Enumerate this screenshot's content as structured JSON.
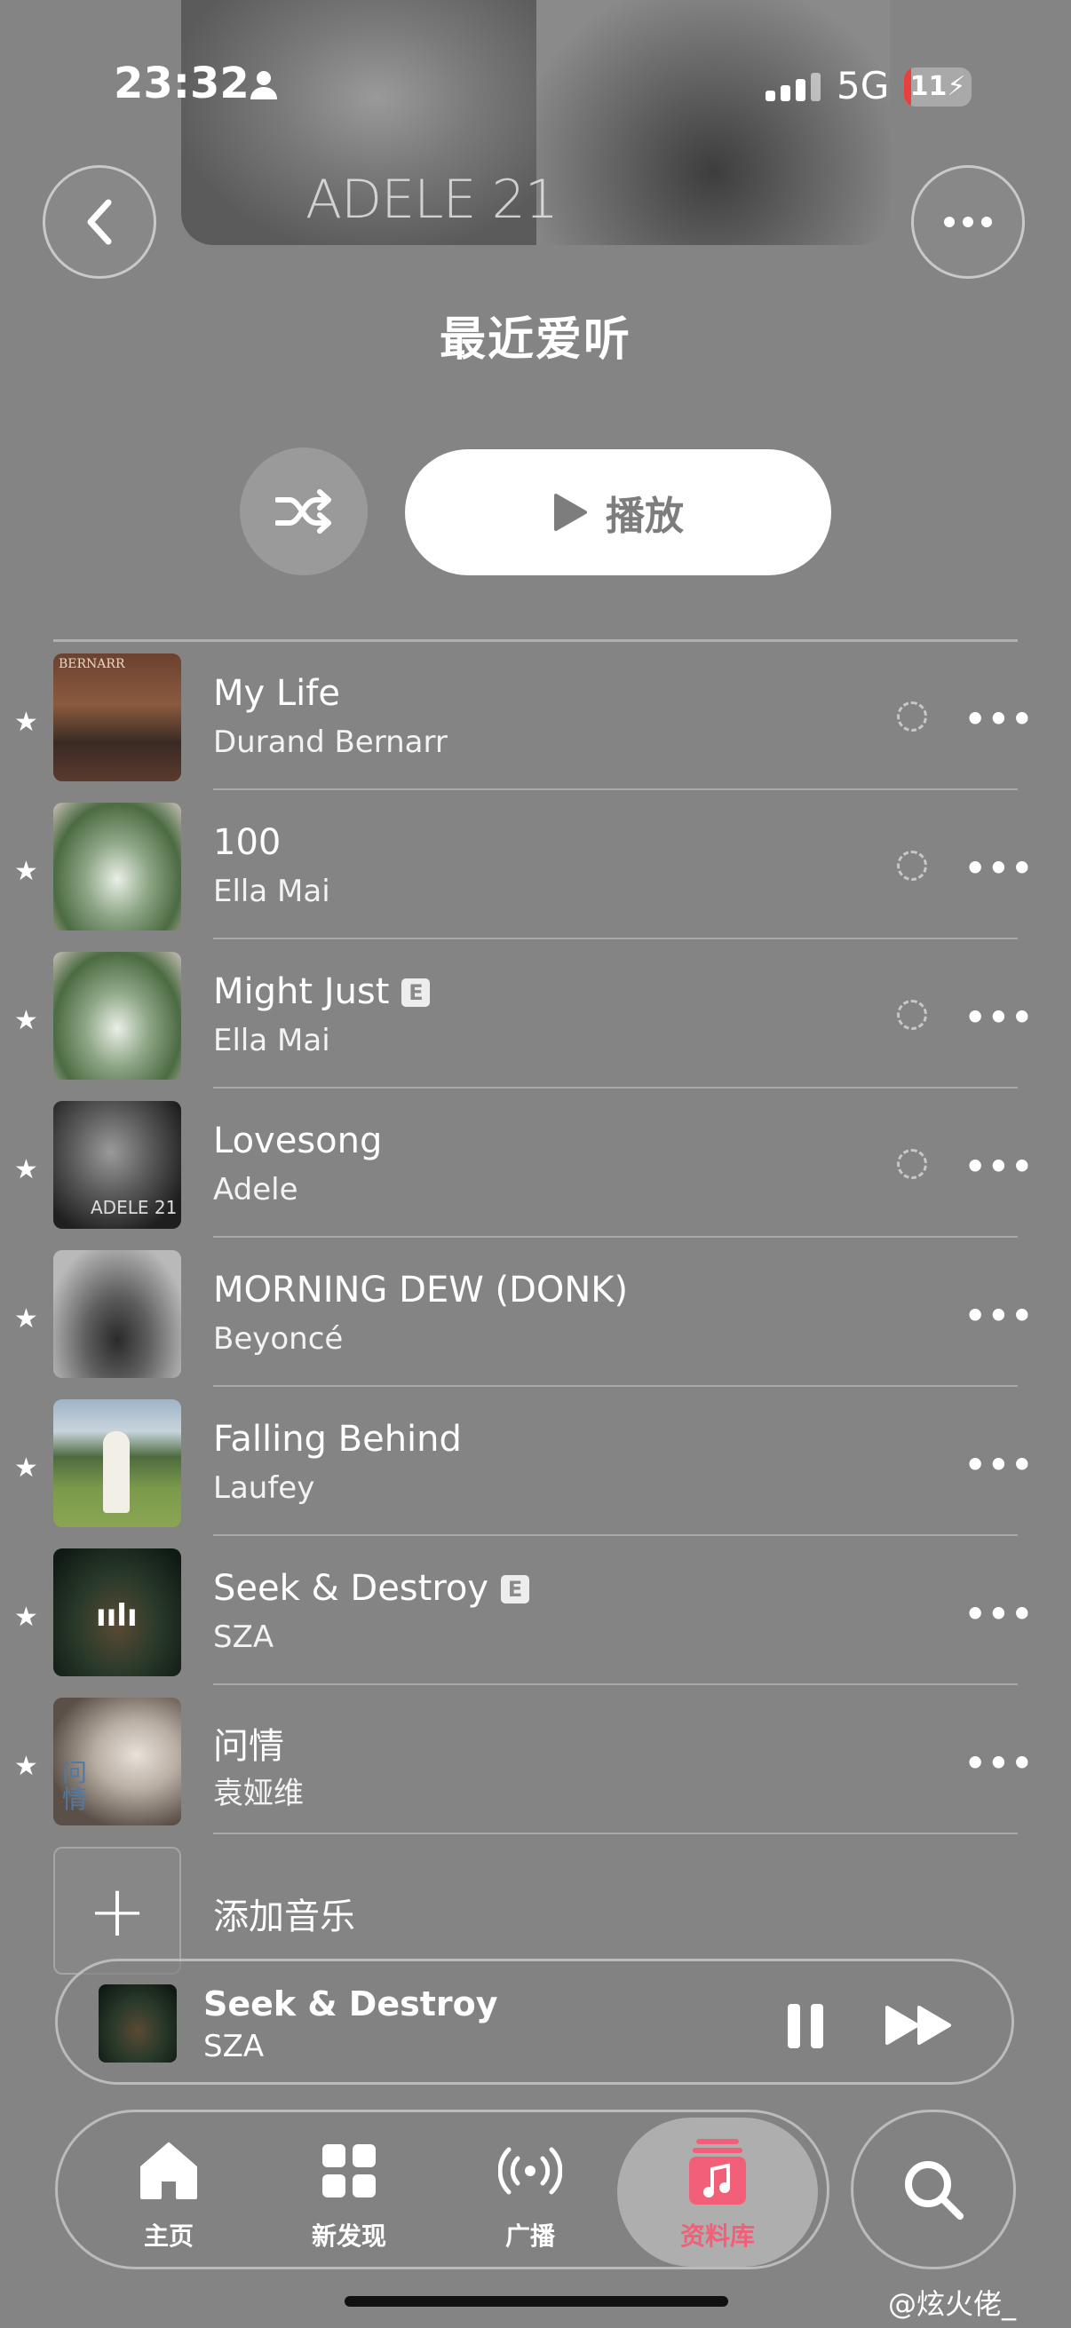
{
  "status": {
    "time": "23:32",
    "network": "5G",
    "battery": "11"
  },
  "header": {
    "artwork_text": "ADELE 21",
    "title": "最近爱听"
  },
  "actions": {
    "play_label": "播放"
  },
  "songs": [
    {
      "title": "My Life",
      "artist": "Durand Bernarr",
      "explicit": false,
      "download_pending": true,
      "favorite": true
    },
    {
      "title": "100",
      "artist": "Ella Mai",
      "explicit": false,
      "download_pending": true,
      "favorite": true
    },
    {
      "title": "Might Just",
      "artist": "Ella Mai",
      "explicit": true,
      "download_pending": true,
      "favorite": true
    },
    {
      "title": "Lovesong",
      "artist": "Adele",
      "explicit": false,
      "download_pending": true,
      "favorite": true
    },
    {
      "title": "MORNING DEW (DONK)",
      "artist": "Beyoncé",
      "explicit": false,
      "download_pending": false,
      "favorite": true
    },
    {
      "title": "Falling Behind",
      "artist": "Laufey",
      "explicit": false,
      "download_pending": false,
      "favorite": true
    },
    {
      "title": "Seek & Destroy",
      "artist": "SZA",
      "explicit": true,
      "download_pending": false,
      "favorite": true
    },
    {
      "title": "问情",
      "artist": "袁娅维",
      "explicit": false,
      "download_pending": false,
      "favorite": true
    }
  ],
  "explicit_badge": "E",
  "add_music_label": "添加音乐",
  "now_playing": {
    "title": "Seek & Destroy",
    "artist": "SZA"
  },
  "tabs": [
    {
      "label": "主页",
      "icon": "home-icon"
    },
    {
      "label": "新发现",
      "icon": "grid-icon"
    },
    {
      "label": "广播",
      "icon": "radio-icon"
    },
    {
      "label": "资料库",
      "icon": "library-icon",
      "active": true
    }
  ],
  "watermark": "@炫火佬_",
  "colors": {
    "accent": "#f25f78",
    "battery_low": "#e8413d"
  }
}
